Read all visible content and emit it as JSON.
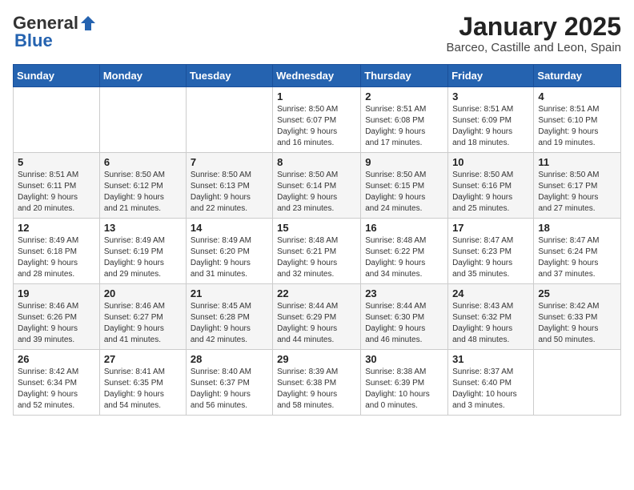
{
  "header": {
    "logo_general": "General",
    "logo_blue": "Blue",
    "month_title": "January 2025",
    "location": "Barceo, Castille and Leon, Spain"
  },
  "weekdays": [
    "Sunday",
    "Monday",
    "Tuesday",
    "Wednesday",
    "Thursday",
    "Friday",
    "Saturday"
  ],
  "weeks": [
    [
      {
        "day": "",
        "info": ""
      },
      {
        "day": "",
        "info": ""
      },
      {
        "day": "",
        "info": ""
      },
      {
        "day": "1",
        "info": "Sunrise: 8:50 AM\nSunset: 6:07 PM\nDaylight: 9 hours\nand 16 minutes."
      },
      {
        "day": "2",
        "info": "Sunrise: 8:51 AM\nSunset: 6:08 PM\nDaylight: 9 hours\nand 17 minutes."
      },
      {
        "day": "3",
        "info": "Sunrise: 8:51 AM\nSunset: 6:09 PM\nDaylight: 9 hours\nand 18 minutes."
      },
      {
        "day": "4",
        "info": "Sunrise: 8:51 AM\nSunset: 6:10 PM\nDaylight: 9 hours\nand 19 minutes."
      }
    ],
    [
      {
        "day": "5",
        "info": "Sunrise: 8:51 AM\nSunset: 6:11 PM\nDaylight: 9 hours\nand 20 minutes."
      },
      {
        "day": "6",
        "info": "Sunrise: 8:50 AM\nSunset: 6:12 PM\nDaylight: 9 hours\nand 21 minutes."
      },
      {
        "day": "7",
        "info": "Sunrise: 8:50 AM\nSunset: 6:13 PM\nDaylight: 9 hours\nand 22 minutes."
      },
      {
        "day": "8",
        "info": "Sunrise: 8:50 AM\nSunset: 6:14 PM\nDaylight: 9 hours\nand 23 minutes."
      },
      {
        "day": "9",
        "info": "Sunrise: 8:50 AM\nSunset: 6:15 PM\nDaylight: 9 hours\nand 24 minutes."
      },
      {
        "day": "10",
        "info": "Sunrise: 8:50 AM\nSunset: 6:16 PM\nDaylight: 9 hours\nand 25 minutes."
      },
      {
        "day": "11",
        "info": "Sunrise: 8:50 AM\nSunset: 6:17 PM\nDaylight: 9 hours\nand 27 minutes."
      }
    ],
    [
      {
        "day": "12",
        "info": "Sunrise: 8:49 AM\nSunset: 6:18 PM\nDaylight: 9 hours\nand 28 minutes."
      },
      {
        "day": "13",
        "info": "Sunrise: 8:49 AM\nSunset: 6:19 PM\nDaylight: 9 hours\nand 29 minutes."
      },
      {
        "day": "14",
        "info": "Sunrise: 8:49 AM\nSunset: 6:20 PM\nDaylight: 9 hours\nand 31 minutes."
      },
      {
        "day": "15",
        "info": "Sunrise: 8:48 AM\nSunset: 6:21 PM\nDaylight: 9 hours\nand 32 minutes."
      },
      {
        "day": "16",
        "info": "Sunrise: 8:48 AM\nSunset: 6:22 PM\nDaylight: 9 hours\nand 34 minutes."
      },
      {
        "day": "17",
        "info": "Sunrise: 8:47 AM\nSunset: 6:23 PM\nDaylight: 9 hours\nand 35 minutes."
      },
      {
        "day": "18",
        "info": "Sunrise: 8:47 AM\nSunset: 6:24 PM\nDaylight: 9 hours\nand 37 minutes."
      }
    ],
    [
      {
        "day": "19",
        "info": "Sunrise: 8:46 AM\nSunset: 6:26 PM\nDaylight: 9 hours\nand 39 minutes."
      },
      {
        "day": "20",
        "info": "Sunrise: 8:46 AM\nSunset: 6:27 PM\nDaylight: 9 hours\nand 41 minutes."
      },
      {
        "day": "21",
        "info": "Sunrise: 8:45 AM\nSunset: 6:28 PM\nDaylight: 9 hours\nand 42 minutes."
      },
      {
        "day": "22",
        "info": "Sunrise: 8:44 AM\nSunset: 6:29 PM\nDaylight: 9 hours\nand 44 minutes."
      },
      {
        "day": "23",
        "info": "Sunrise: 8:44 AM\nSunset: 6:30 PM\nDaylight: 9 hours\nand 46 minutes."
      },
      {
        "day": "24",
        "info": "Sunrise: 8:43 AM\nSunset: 6:32 PM\nDaylight: 9 hours\nand 48 minutes."
      },
      {
        "day": "25",
        "info": "Sunrise: 8:42 AM\nSunset: 6:33 PM\nDaylight: 9 hours\nand 50 minutes."
      }
    ],
    [
      {
        "day": "26",
        "info": "Sunrise: 8:42 AM\nSunset: 6:34 PM\nDaylight: 9 hours\nand 52 minutes."
      },
      {
        "day": "27",
        "info": "Sunrise: 8:41 AM\nSunset: 6:35 PM\nDaylight: 9 hours\nand 54 minutes."
      },
      {
        "day": "28",
        "info": "Sunrise: 8:40 AM\nSunset: 6:37 PM\nDaylight: 9 hours\nand 56 minutes."
      },
      {
        "day": "29",
        "info": "Sunrise: 8:39 AM\nSunset: 6:38 PM\nDaylight: 9 hours\nand 58 minutes."
      },
      {
        "day": "30",
        "info": "Sunrise: 8:38 AM\nSunset: 6:39 PM\nDaylight: 10 hours\nand 0 minutes."
      },
      {
        "day": "31",
        "info": "Sunrise: 8:37 AM\nSunset: 6:40 PM\nDaylight: 10 hours\nand 3 minutes."
      },
      {
        "day": "",
        "info": ""
      }
    ]
  ]
}
